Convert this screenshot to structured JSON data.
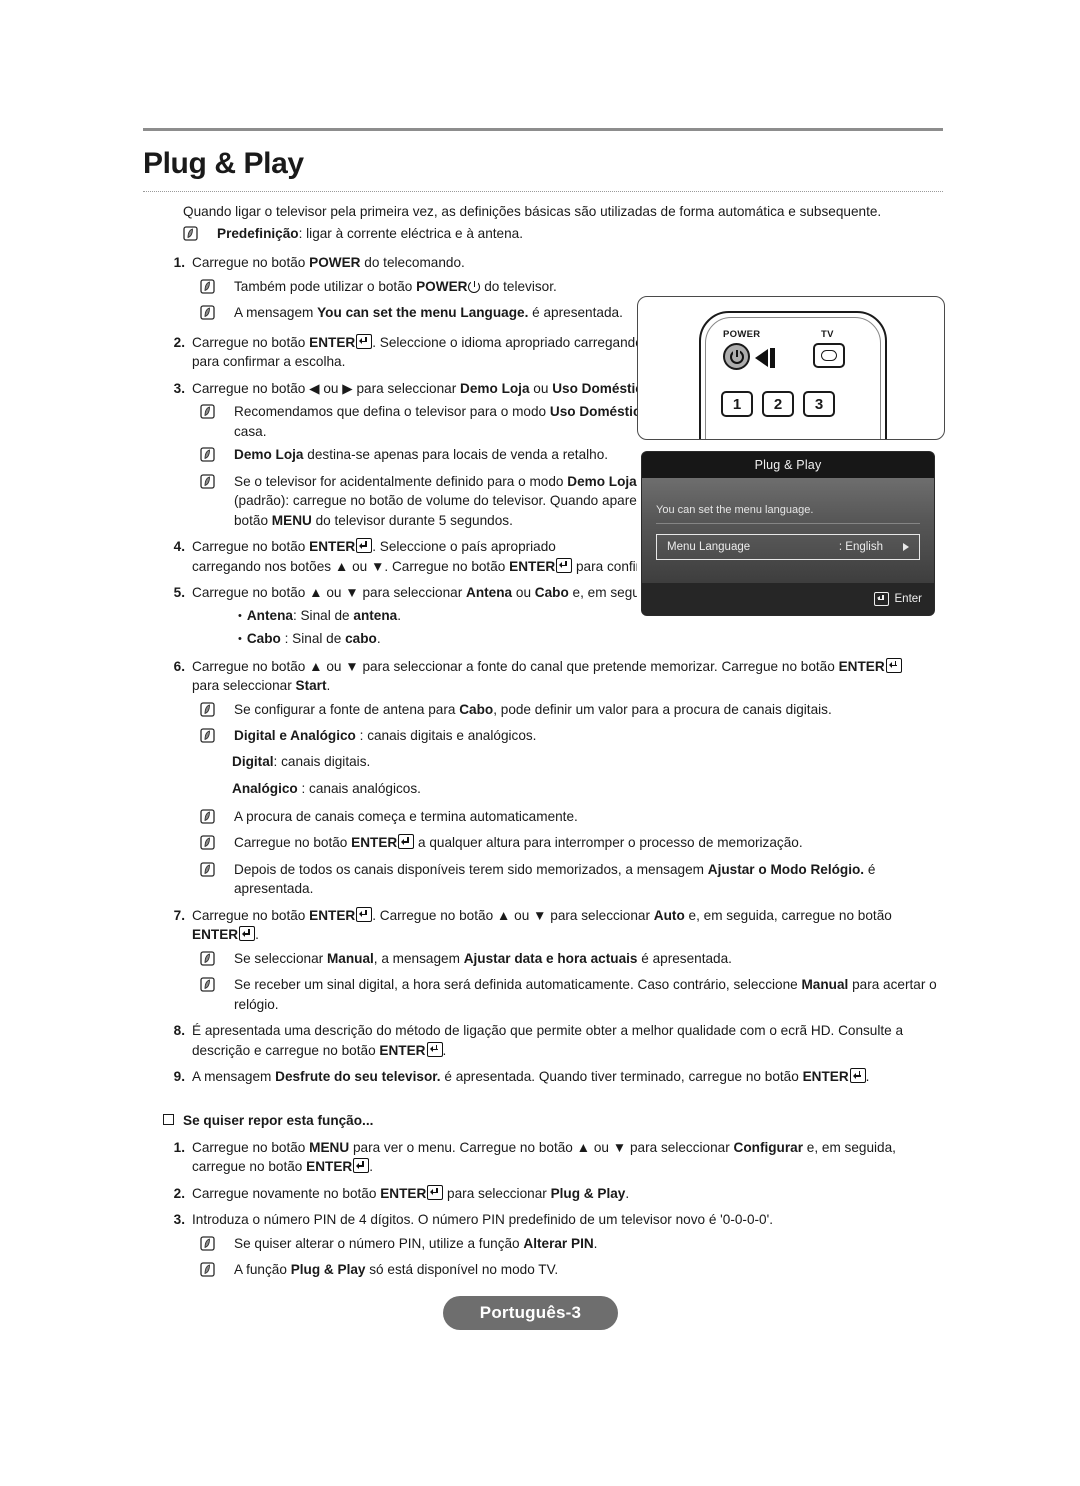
{
  "page": {
    "title": "Plug & Play",
    "footer_label": "Português-3"
  },
  "intro": {
    "paragraph": "Quando ligar o televisor pela primeira vez, as definições básicas são utilizadas de forma automática e subsequente.",
    "note_bold": "Predefinição",
    "note_rest": ": ligar à corrente eléctrica e à antena."
  },
  "steps": [
    {
      "num": "1.",
      "text_1": "Carregue no botão ",
      "bold_1": "POWER",
      "text_2": " do telecomando.",
      "notes": [
        {
          "pre": "Também pode utilizar o botão ",
          "bold": "POWER",
          "post": " do televisor.",
          "glyph": "power-glyph"
        },
        {
          "pre": "A mensagem ",
          "bold": "You can set the menu Language.",
          "post": " é apresentada."
        }
      ]
    },
    {
      "num": "2.",
      "line": "Carregue no botão ENTER. Seleccione o idioma apropriado carregando no botão ▲ ou ▼. Carregue no botão ENTER para confirmar a escolha."
    },
    {
      "num": "3.",
      "line": "Carregue no botão ◀ ou ▶ para seleccionar Demo Loja ou Uso Doméstico e, em seguida, carregue no botão ENTER.",
      "notes": [
        {
          "text": "Recomendamos que defina o televisor para o modo Uso Doméstico, de forma a usufruir da melhor imagem em sua casa."
        },
        {
          "text": "Demo Loja destina-se apenas para locais de venda a retalho."
        },
        {
          "text": "Se o televisor for acidentalmente definido para o modo Demo Loja e quiser voltar ao modo Uso Doméstico (padrão): carregue no botão de volume do televisor. Quando aparecer o OSD de volume, carregue sem soltar o botão MENU do televisor durante 5 segundos."
        }
      ]
    },
    {
      "num": "4.",
      "line": "Carregue no botão ENTER. Seleccione o país apropriado carregando nos botões ▲ ou ▼. Carregue no botão ENTER para confirmar a escolha."
    },
    {
      "num": "5.",
      "line": "Carregue no botão ▲ ou ▼ para seleccionar Antena ou Cabo e, em seguida, carregue no botão ENTER.",
      "bullets": [
        {
          "bold": "Antena",
          "rest": ": Sinal de ",
          "boldend": "antena",
          "tail": "."
        },
        {
          "bold": "Cabo",
          "rest": " : Sinal de ",
          "boldend": "cabo",
          "tail": "."
        }
      ]
    },
    {
      "num": "6.",
      "line": "Carregue no botão ▲ ou ▼ para seleccionar a fonte do canal que pretende memorizar. Carregue no botão ENTER para seleccionar Start.",
      "notes": [
        {
          "text": "Se configurar a fonte de antena para Cabo, pode definir um valor para a procura de canais digitais."
        },
        {
          "text": "Digital e Analógico : canais digitais e analógicos."
        },
        {
          "text": "A procura de canais começa e termina automaticamente."
        },
        {
          "text": "Carregue no botão ENTER a qualquer altura para interromper o processo de memorização."
        },
        {
          "text": "Depois de todos os canais disponíveis terem sido memorizados, a mensagem Ajustar o Modo Relógio. é apresentada."
        }
      ],
      "sub_lines": [
        {
          "bold": "Digital",
          "rest": ": canais digitais."
        },
        {
          "bold": "Analógico",
          "rest": " : canais analógicos."
        }
      ]
    },
    {
      "num": "7.",
      "line": "Carregue no botão ENTER. Carregue no botão ▲ ou ▼ para seleccionar Auto e, em seguida, carregue no botão ENTER.",
      "notes": [
        {
          "text": "Se seleccionar Manual, a mensagem Ajustar data e hora actuais é apresentada."
        },
        {
          "text": "Se receber um sinal digital, a hora será definida automaticamente. Caso contrário, seleccione Manual para acertar o relógio."
        }
      ]
    },
    {
      "num": "8.",
      "line": "É apresentada uma descrição do método de ligação que permite obter a melhor qualidade com o ecrã HD. Consulte a descrição e carregue no botão ENTER."
    },
    {
      "num": "9.",
      "line": "A mensagem Desfrute do seu televisor. é apresentada. Quando tiver terminado, carregue no botão ENTER."
    }
  ],
  "reset_section": {
    "heading": "Se quiser repor esta função...",
    "steps": [
      {
        "num": "1.",
        "line": "Carregue no botão MENU para ver o menu. Carregue no botão ▲ ou ▼ para seleccionar Configurar e, em seguida, carregue no botão ENTER."
      },
      {
        "num": "2.",
        "line": "Carregue novamente no botão ENTER para seleccionar Plug & Play."
      },
      {
        "num": "3.",
        "line": "Introduza o número PIN de 4 dígitos. O número PIN predefinido de um televisor novo é '0-0-0-0'.",
        "notes": [
          {
            "text": "Se quiser alterar o número PIN, utilize a função Alterar PIN."
          },
          {
            "text": "A função Plug & Play só está disponível no modo TV."
          }
        ]
      }
    ]
  },
  "figures": {
    "remote": {
      "power_label": "POWER",
      "tv_label": "TV",
      "keys": [
        "1",
        "2",
        "3"
      ]
    },
    "osd": {
      "title": "Plug & Play",
      "description": "You can set the menu language.",
      "row_label": "Menu Language",
      "row_value": ": English",
      "footer_label": "Enter"
    }
  },
  "colors": {
    "rule": "#8d8d8d",
    "badge_bg": "#6e6e6e",
    "osd_title_bg": "#171717"
  }
}
